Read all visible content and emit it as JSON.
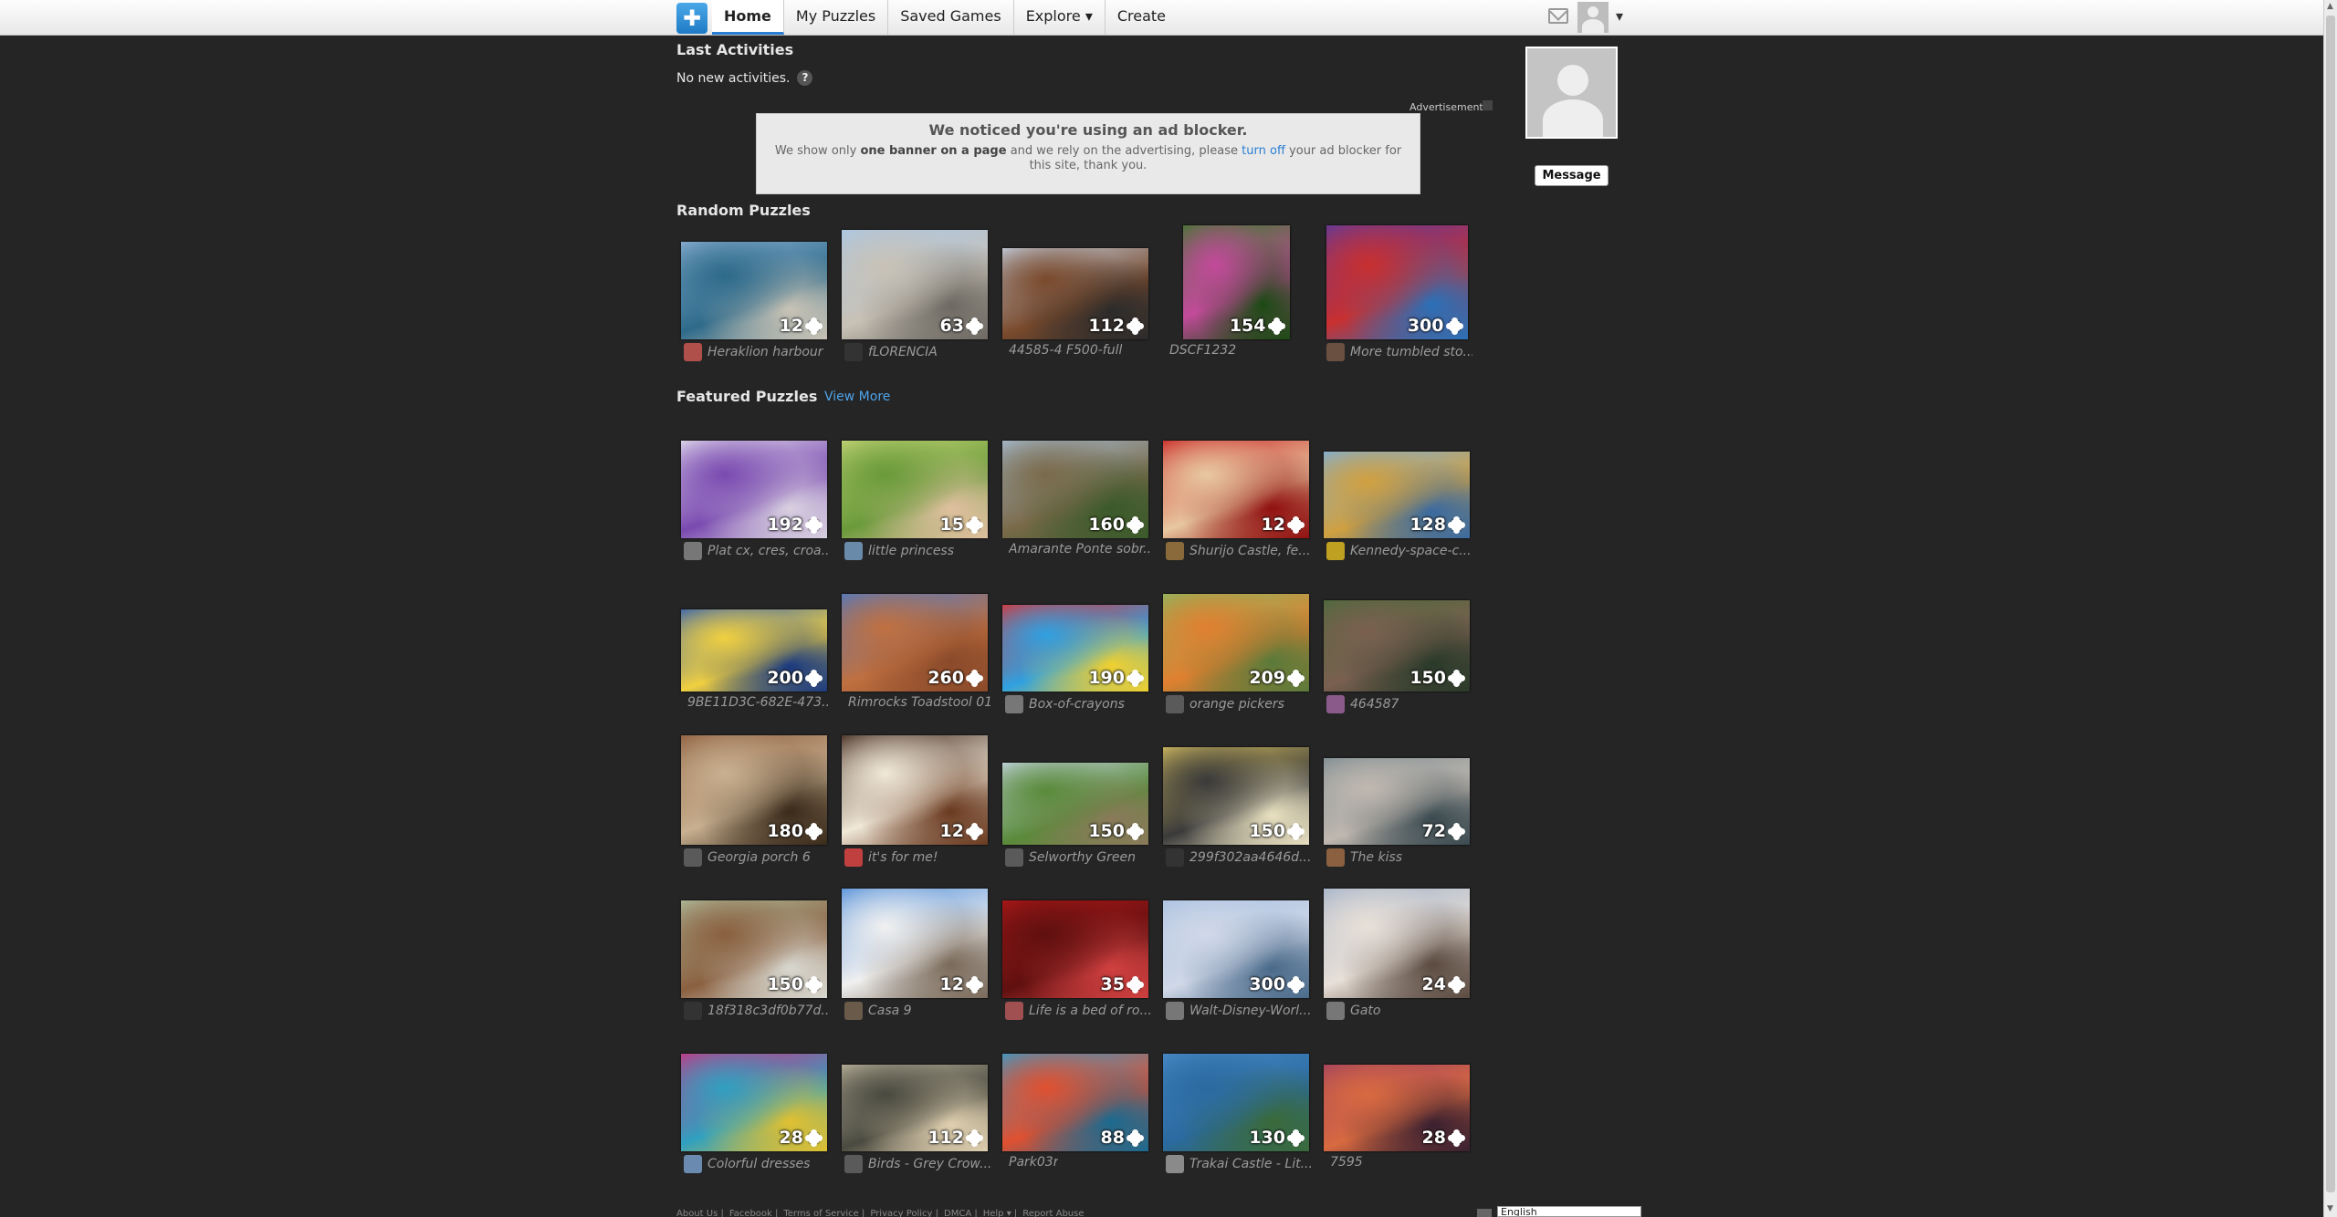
{
  "nav": {
    "items": [
      "Home",
      "My Puzzles",
      "Saved Games",
      "Explore ▾",
      "Create"
    ],
    "active": "Home"
  },
  "user_menu": {
    "caret": "▾"
  },
  "activities": {
    "title": "Last Activities",
    "empty_text": "No new activities.",
    "help": "?"
  },
  "ad": {
    "label": "Advertisement",
    "title": "We noticed you're using an ad blocker.",
    "text_1": "We show only",
    "text_bold": "one banner on a page",
    "text_2": "and we rely on the advertising, please",
    "link": "turn off",
    "text_3": "your ad blocker for this site, thank you."
  },
  "profile": {
    "message_label": "Message"
  },
  "random": {
    "title": "Random Puzzles",
    "puzzles": [
      {
        "count": "12",
        "title": "Heraklion harbour",
        "colors": [
          "#8fb3d6",
          "#2d6a8a",
          "#c9c3b5"
        ],
        "avatar": "#b0504a"
      },
      {
        "count": "63",
        "title": "fLORENCIA",
        "colors": [
          "#a9c7e8",
          "#c8c2b6",
          "#6e6a63"
        ],
        "avatar": "#333333"
      },
      {
        "count": "112",
        "title": "44585-4 F500-full",
        "colors": [
          "#c7d6e8",
          "#7a4a2c",
          "#2b2b2b"
        ],
        "avatar": ""
      },
      {
        "count": "154",
        "title": "DSCF1232",
        "colors": [
          "#3a7a2a",
          "#c24a9a",
          "#1c4a14"
        ],
        "avatar": ""
      },
      {
        "count": "300",
        "title": "More tumbled sto...",
        "colors": [
          "#5a3aa0",
          "#c83030",
          "#2a70b8"
        ],
        "avatar": "#6a5040"
      }
    ]
  },
  "featured": {
    "title": "Featured Puzzles",
    "view_more": "View More",
    "puzzles": [
      {
        "count": "192",
        "title": "Plat cx, cres, croa...",
        "colors": [
          "#e8e4f0",
          "#7a4ab0",
          "#d8d0e0"
        ],
        "avatar": "#777777"
      },
      {
        "count": "15",
        "title": "little princess",
        "colors": [
          "#c8d87a",
          "#6a9a3a",
          "#e0c0a0"
        ],
        "avatar": "#6a8aaa"
      },
      {
        "count": "160",
        "title": "Amarante Ponte sobr...",
        "colors": [
          "#a8c0d8",
          "#7a6a4a",
          "#3a5a2a"
        ],
        "avatar": ""
      },
      {
        "count": "12",
        "title": "Shurijo Castle, fe...",
        "colors": [
          "#c82020",
          "#e8c8a0",
          "#901010"
        ],
        "avatar": "#8a6a3a"
      },
      {
        "count": "128",
        "title": "Kennedy-space-c...",
        "colors": [
          "#7ab0e0",
          "#d0a040",
          "#3a6aa0"
        ],
        "avatar": "#c0a020"
      },
      {
        "count": "200",
        "title": "9BE11D3C-682E-473...",
        "colors": [
          "#2a5ab8",
          "#f0d040",
          "#1a3a80"
        ],
        "avatar": ""
      },
      {
        "count": "260",
        "title": "Rimrocks Toadstool 01",
        "colors": [
          "#4a7ac8",
          "#c07040",
          "#8a4a2a"
        ],
        "avatar": ""
      },
      {
        "count": "190",
        "title": "Box-of-crayons",
        "colors": [
          "#e03030",
          "#30a0e0",
          "#f0d030"
        ],
        "avatar": "#777777"
      },
      {
        "count": "209",
        "title": "orange pickers",
        "colors": [
          "#8ab860",
          "#e08030",
          "#5a7a3a"
        ],
        "avatar": "#5a5a5a"
      },
      {
        "count": "150",
        "title": "464587",
        "colors": [
          "#4a6a3a",
          "#7a6050",
          "#2a3a2a"
        ],
        "avatar": "#8a5a8a"
      },
      {
        "count": "180",
        "title": "Georgia porch 6",
        "colors": [
          "#8a5a3a",
          "#c8b090",
          "#3a2a1a"
        ],
        "avatar": "#5a5a5a"
      },
      {
        "count": "12",
        "title": "it's for me!",
        "colors": [
          "#3a2014",
          "#f0e8d8",
          "#6a3a20"
        ],
        "avatar": "#c04040"
      },
      {
        "count": "150",
        "title": "Selworthy Green",
        "colors": [
          "#c8d8e8",
          "#5a8a3a",
          "#8a7a5a"
        ],
        "avatar": "#5a5a5a"
      },
      {
        "count": "150",
        "title": "299f302aa4646d...",
        "colors": [
          "#d8c060",
          "#3a3a3a",
          "#e8e0c0"
        ],
        "avatar": "#333333"
      },
      {
        "count": "72",
        "title": "The kiss",
        "colors": [
          "#7a8a90",
          "#c0b8b0",
          "#3a4a50"
        ],
        "avatar": "#8a6040"
      },
      {
        "count": "150",
        "title": "18f318c3df0b77d...",
        "colors": [
          "#b0c0a0",
          "#8a6040",
          "#d8d8d0"
        ],
        "avatar": "#333333"
      },
      {
        "count": "12",
        "title": "Casa 9",
        "colors": [
          "#4a8ad8",
          "#f0f0f0",
          "#7a6a5a"
        ],
        "avatar": "#6a5a4a"
      },
      {
        "count": "35",
        "title": "Life is a bed of ro...",
        "colors": [
          "#b01818",
          "#601010",
          "#d04040"
        ],
        "avatar": "#a05050"
      },
      {
        "count": "300",
        "title": "Walt-Disney-Worl...",
        "colors": [
          "#a8c0e0",
          "#d0d8e8",
          "#4a6a8a"
        ],
        "avatar": "#777777"
      },
      {
        "count": "24",
        "title": "Gato",
        "colors": [
          "#a0b0c8",
          "#e8e0d8",
          "#5a4a40"
        ],
        "avatar": "#777777"
      },
      {
        "count": "28",
        "title": "Colorful dresses",
        "colors": [
          "#d03080",
          "#30a0c0",
          "#e0c030"
        ],
        "avatar": "#6a8ab0"
      },
      {
        "count": "112",
        "title": "Birds - Grey Crow...",
        "colors": [
          "#c0b8a0",
          "#4a4a40",
          "#e0d0b0"
        ],
        "avatar": "#5a5a5a"
      },
      {
        "count": "88",
        "title": "Park03r",
        "colors": [
          "#30a0d0",
          "#e05030",
          "#1a6a90"
        ],
        "avatar": ""
      },
      {
        "count": "130",
        "title": "Trakai Castle - Lit...",
        "colors": [
          "#4a8ac8",
          "#2a6aa0",
          "#3a6a3a"
        ],
        "avatar": "#8a8a8a"
      },
      {
        "count": "28",
        "title": "7595",
        "colors": [
          "#a04060",
          "#d86a40",
          "#3a2030"
        ],
        "avatar": ""
      }
    ]
  },
  "footer": {
    "links": [
      "About Us |",
      "Facebook |",
      "Terms of Service |",
      "Privacy Policy |",
      "DMCA |",
      "Help ▾ |",
      "Report Abuse"
    ],
    "language": "English"
  }
}
